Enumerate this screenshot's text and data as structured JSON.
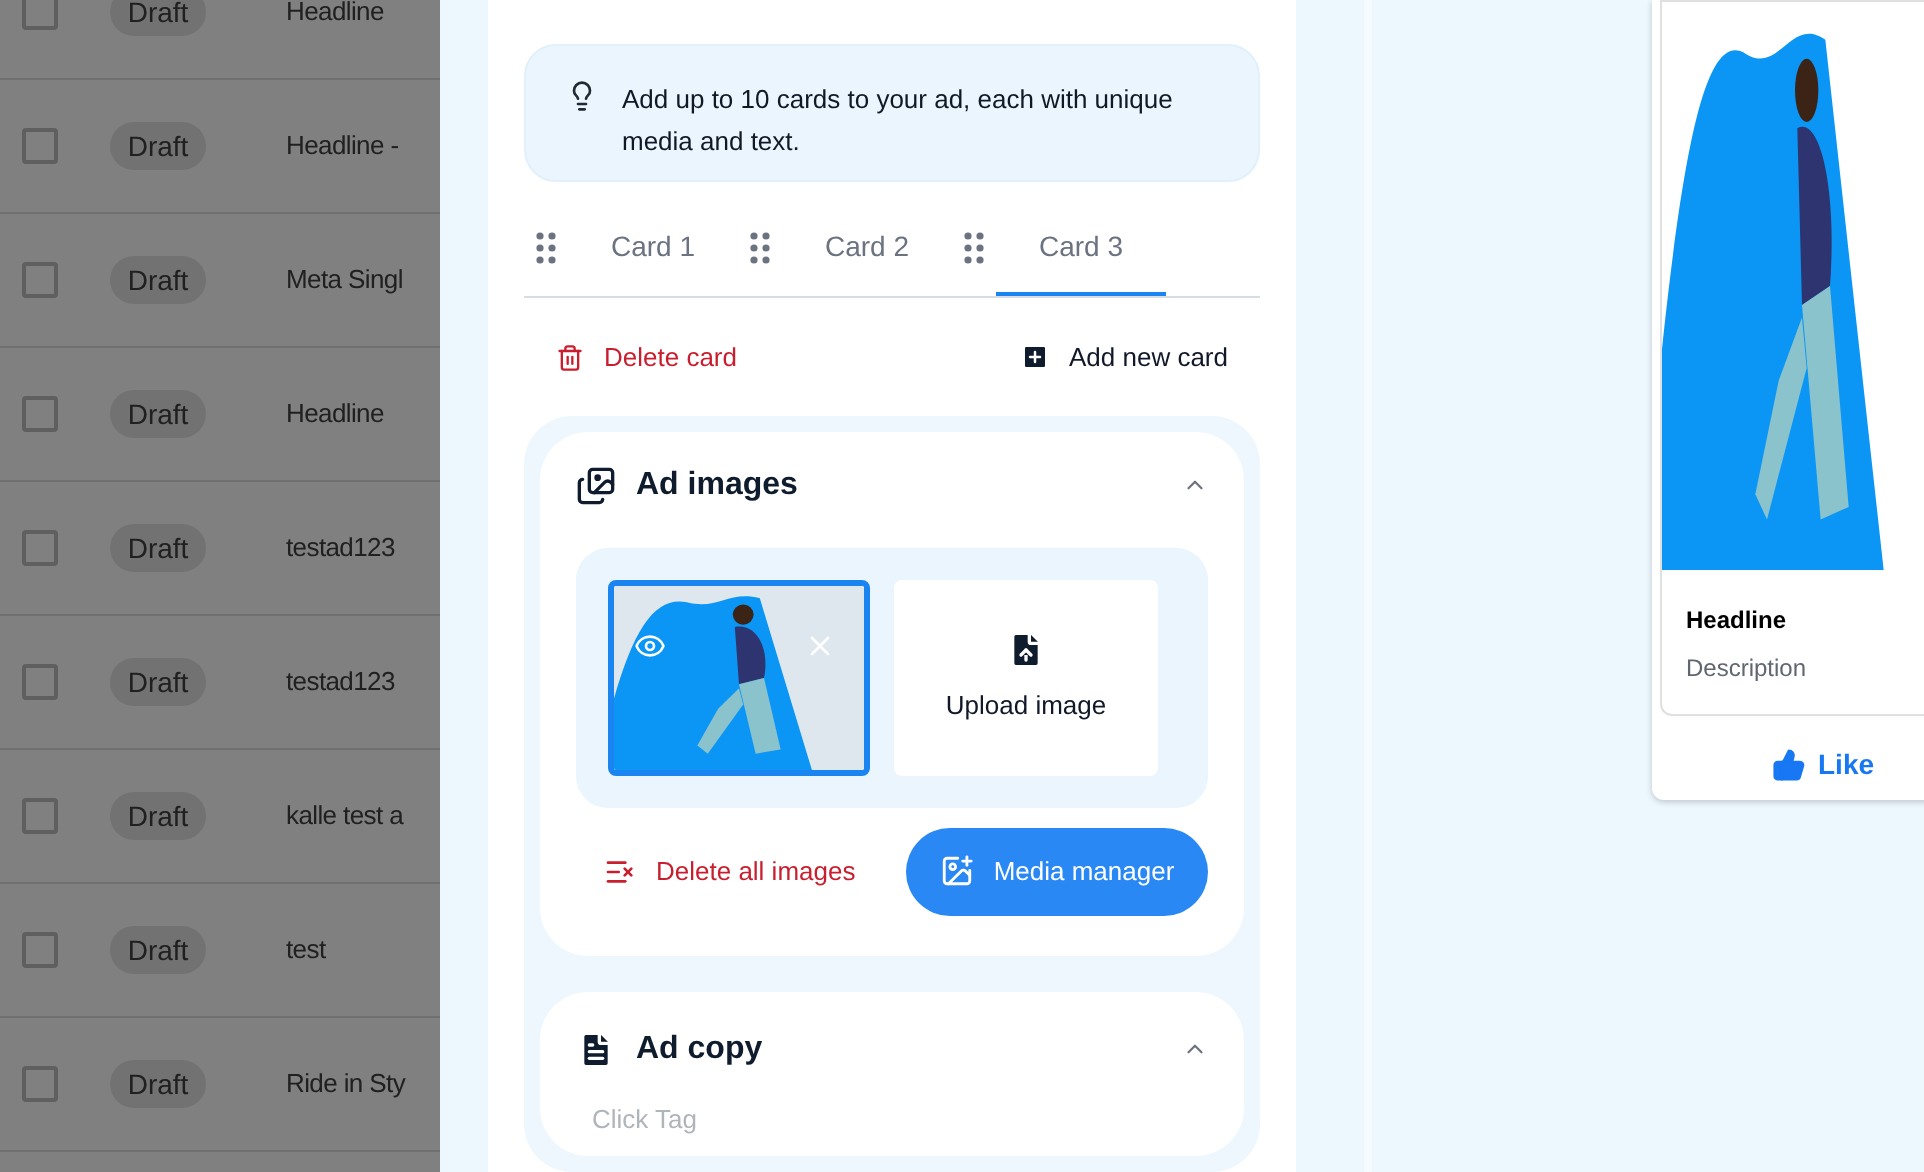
{
  "table": {
    "rows": [
      {
        "checked": false,
        "status": "Draft",
        "name": "Headline"
      },
      {
        "checked": false,
        "status": "Draft",
        "name": "Headline -"
      },
      {
        "checked": false,
        "status": "Draft",
        "name": "Meta Singl"
      },
      {
        "checked": false,
        "status": "Draft",
        "name": "Headline"
      },
      {
        "checked": false,
        "status": "Draft",
        "name": "testad123"
      },
      {
        "checked": false,
        "status": "Draft",
        "name": "testad123"
      },
      {
        "checked": false,
        "status": "Draft",
        "name": "kalle test a"
      },
      {
        "checked": false,
        "status": "Draft",
        "name": "test"
      },
      {
        "checked": false,
        "status": "Draft",
        "name": "Ride in Sty"
      }
    ]
  },
  "tip": "Add up to 10 cards to your ad, each with unique media and text.",
  "tabs": [
    {
      "label": "Card 1",
      "selected": false
    },
    {
      "label": "Card 2",
      "selected": false
    },
    {
      "label": "Card 3",
      "selected": true
    }
  ],
  "card_actions": {
    "delete": "Delete card",
    "add": "Add new card"
  },
  "ad_images": {
    "title": "Ad images",
    "expanded": true,
    "images": [
      {
        "selected": true
      }
    ],
    "upload": "Upload image",
    "delete_all": "Delete all images",
    "media_manager": "Media manager"
  },
  "ad_copy": {
    "title": "Ad copy",
    "expanded": true,
    "field_label": "Click Tag"
  },
  "preview": {
    "headline": "Headline",
    "description": "Description",
    "like": "Like"
  }
}
